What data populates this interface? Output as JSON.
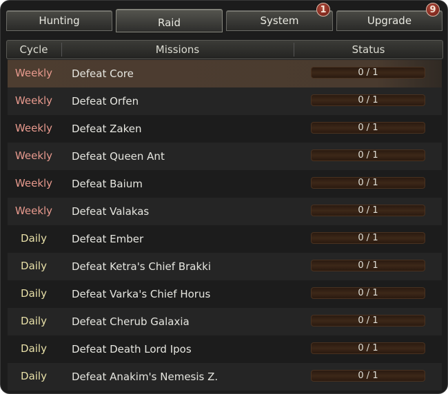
{
  "tabs": [
    {
      "label": "Hunting"
    },
    {
      "label": "Raid"
    },
    {
      "label": "System",
      "badge": "1"
    },
    {
      "label": "Upgrade",
      "badge": "9"
    }
  ],
  "active_tab": "Raid",
  "header": {
    "cycle": "Cycle",
    "missions": "Missions",
    "status": "Status"
  },
  "colors": {
    "weekly": "#e89a8e",
    "daily": "#e8e0a8",
    "highlight": "#4d3d30"
  },
  "missions": [
    {
      "cycle": "Weekly",
      "name": "Defeat Core",
      "status": "0 / 1",
      "progress": 0
    },
    {
      "cycle": "Weekly",
      "name": "Defeat Orfen",
      "status": "0 / 1",
      "progress": 0
    },
    {
      "cycle": "Weekly",
      "name": "Defeat Zaken",
      "status": "0 / 1",
      "progress": 0
    },
    {
      "cycle": "Weekly",
      "name": "Defeat Queen Ant",
      "status": "0 / 1",
      "progress": 0
    },
    {
      "cycle": "Weekly",
      "name": "Defeat Baium",
      "status": "0 / 1",
      "progress": 0
    },
    {
      "cycle": "Weekly",
      "name": "Defeat Valakas",
      "status": "0 / 1",
      "progress": 0
    },
    {
      "cycle": "Daily",
      "name": "Defeat Ember",
      "status": "0 / 1",
      "progress": 0
    },
    {
      "cycle": "Daily",
      "name": "Defeat Ketra's Chief Brakki",
      "status": "0 / 1",
      "progress": 0
    },
    {
      "cycle": "Daily",
      "name": "Defeat Varka's Chief Horus",
      "status": "0 / 1",
      "progress": 0
    },
    {
      "cycle": "Daily",
      "name": "Defeat Cherub Galaxia",
      "status": "0 / 1",
      "progress": 0
    },
    {
      "cycle": "Daily",
      "name": "Defeat Death Lord Ipos",
      "status": "0 / 1",
      "progress": 0
    },
    {
      "cycle": "Daily",
      "name": "Defeat Anakim's Nemesis Z.",
      "status": "0 / 1",
      "progress": 0
    }
  ]
}
